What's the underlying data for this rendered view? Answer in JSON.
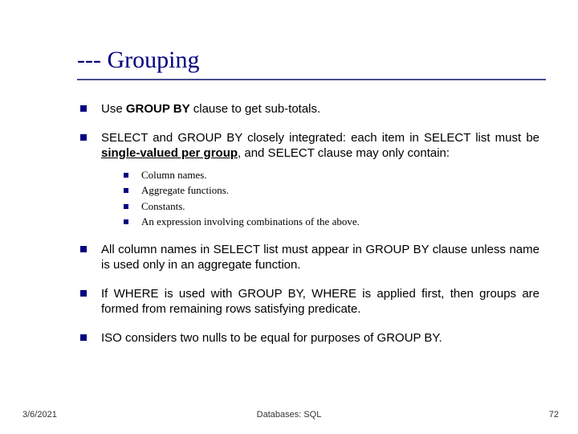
{
  "title": "--- Grouping",
  "bullets": {
    "b1_pre": "Use ",
    "b1_bold": "GROUP BY",
    "b1_post": " clause to get sub-totals.",
    "b2_pre": "SELECT and GROUP BY closely integrated: each item in SELECT list must be ",
    "b2_bold_under": "single-valued per group",
    "b2_post": ", and SELECT clause may only contain:",
    "b2_sub": [
      "Column names.",
      "Aggregate functions.",
      "Constants.",
      "An expression involving combinations of the above."
    ],
    "b3": "All column names in SELECT list must appear in GROUP BY clause unless name is used only in an aggregate function.",
    "b4": "If WHERE is used with GROUP BY, WHERE is applied first, then groups are formed from remaining rows satisfying predicate.",
    "b5": "ISO considers two nulls to be equal for purposes of GROUP BY."
  },
  "footer": {
    "date": "3/6/2021",
    "middle": "Databases: SQL",
    "page": "72"
  }
}
